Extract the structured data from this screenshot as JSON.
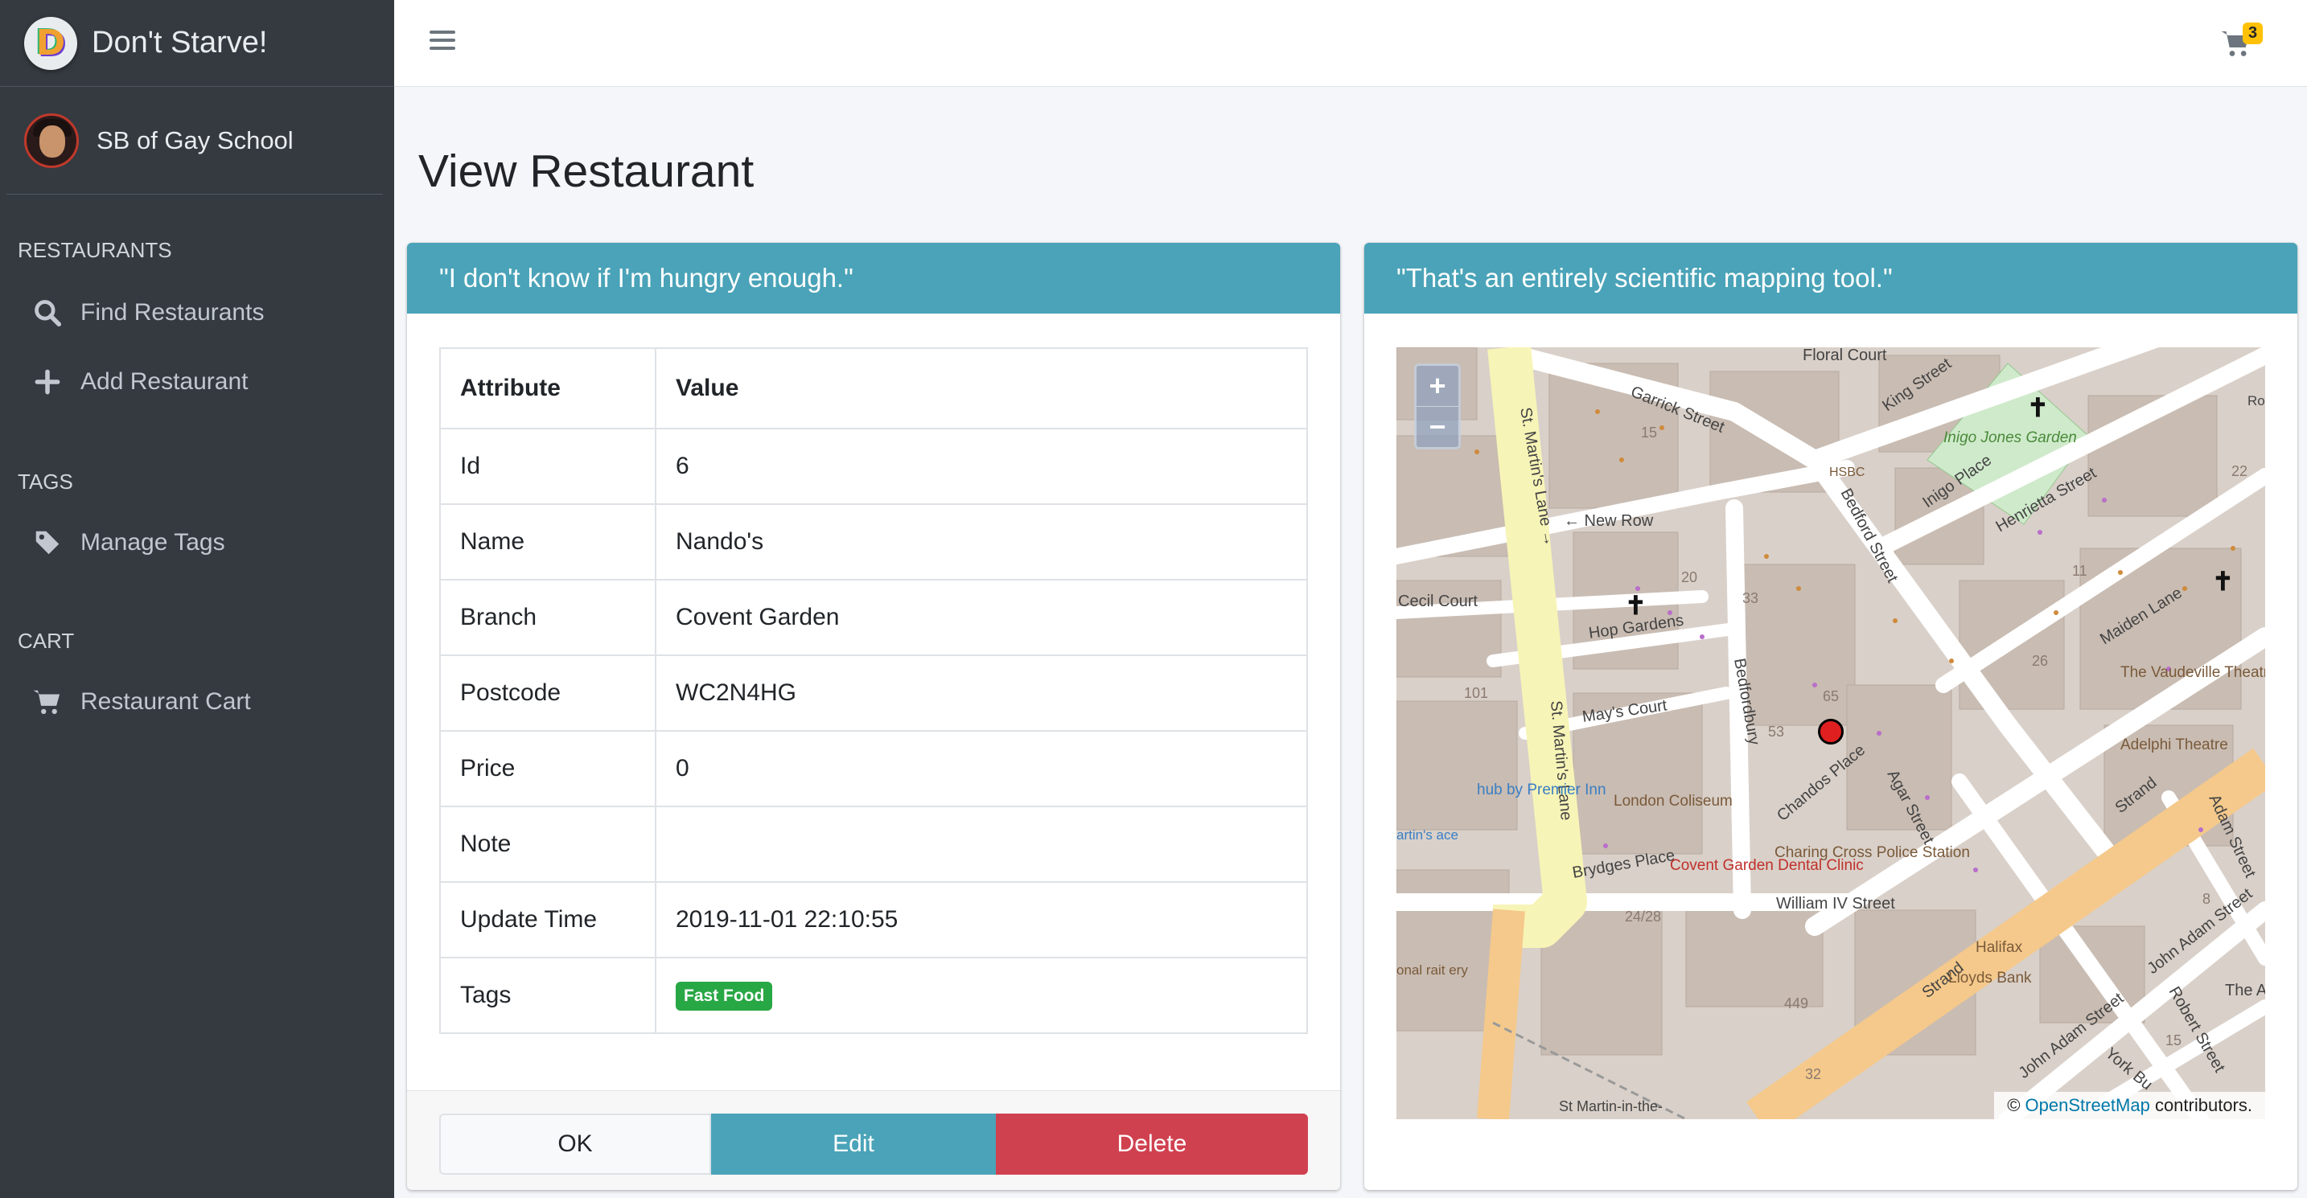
{
  "brand": {
    "name": "Don't Starve!",
    "logo_letter": "D"
  },
  "user": {
    "name": "SB of Gay School"
  },
  "sidebar": {
    "sections": [
      {
        "header": "RESTAURANTS",
        "items": [
          {
            "label": "Find Restaurants",
            "icon": "search-icon"
          },
          {
            "label": "Add Restaurant",
            "icon": "plus-icon"
          }
        ]
      },
      {
        "header": "TAGS",
        "items": [
          {
            "label": "Manage Tags",
            "icon": "tag-icon"
          }
        ]
      },
      {
        "header": "CART",
        "items": [
          {
            "label": "Restaurant Cart",
            "icon": "cart-icon"
          }
        ]
      }
    ]
  },
  "topbar": {
    "cart_count": "3"
  },
  "page": {
    "title": "View Restaurant"
  },
  "details_card": {
    "header": "\"I don't know if I'm hungry enough.\"",
    "columns": [
      "Attribute",
      "Value"
    ],
    "rows": [
      {
        "attribute": "Id",
        "value": "6"
      },
      {
        "attribute": "Name",
        "value": "Nando's"
      },
      {
        "attribute": "Branch",
        "value": "Covent Garden"
      },
      {
        "attribute": "Postcode",
        "value": "WC2N4HG"
      },
      {
        "attribute": "Price",
        "value": "0"
      },
      {
        "attribute": "Note",
        "value": ""
      },
      {
        "attribute": "Update Time",
        "value": "2019-11-01 22:10:55"
      },
      {
        "attribute": "Tags",
        "value": ""
      }
    ],
    "tags": [
      "Fast Food"
    ],
    "buttons": {
      "ok": "OK",
      "edit": "Edit",
      "delete": "Delete"
    }
  },
  "map_card": {
    "header": "\"That's an entirely scientific mapping tool.\"",
    "zoom_in": "+",
    "zoom_out": "−",
    "attribution_prefix": "© ",
    "attribution_link": "OpenStreetMap",
    "attribution_suffix": " contributors.",
    "labels": {
      "floral_court": "Floral Court",
      "garrick_street": "Garrick Street",
      "king_street": "King Street",
      "inigo_jones_garden": "Inigo Jones Garden",
      "inigo_place": "Inigo Place",
      "hsbc": "HSBC",
      "new_row": "← New Row",
      "bedford_street": "Bedford Street",
      "henrietta_street": "Henrietta Street",
      "st_martins_lane_top": "St. Martin's Lane →",
      "st_martins_lane": "St. Martin's Lane",
      "cecil_court": "Cecil Court",
      "hop_gardens": "Hop Gardens",
      "maiden_lane": "Maiden Lane",
      "vaudeville": "The Vaudeville Theatre",
      "mays_court": "May's Court",
      "bedfordbury": "Bedfordbury",
      "chandos_place": "Chandos Place",
      "agar_street": "Agar Street",
      "adelphi": "Adelphi Theatre",
      "strand": "Strand",
      "adam_street": "Adam Street",
      "london_coliseum": "London Coliseum",
      "brydges_place": "Brydges Place",
      "hub": "hub by Premier Inn",
      "charing_cross": "Charing Cross Police Station",
      "dental": "Covent Garden Dental Clinic",
      "william_iv": "William IV Street",
      "john_adam": "John Adam Street",
      "robert_street": "Robert Street",
      "york_bu": "York Bu",
      "lloyds": "Lloyds Bank",
      "halifax": "Halifax",
      "st_martin": "St Martin-in-the-",
      "n15": "15",
      "n20": "20",
      "n33": "33",
      "n65": "65",
      "n53": "53",
      "n101": "101",
      "n2428": "24/28",
      "n449": "449",
      "n22": "22",
      "n11": "11",
      "n26": "26",
      "n8": "8",
      "n32": "32",
      "n15b": "15",
      "the_ad": "The Ad",
      "roa": "Roa",
      "artins": "artin's ace",
      "onal": "onal rait ery"
    }
  }
}
